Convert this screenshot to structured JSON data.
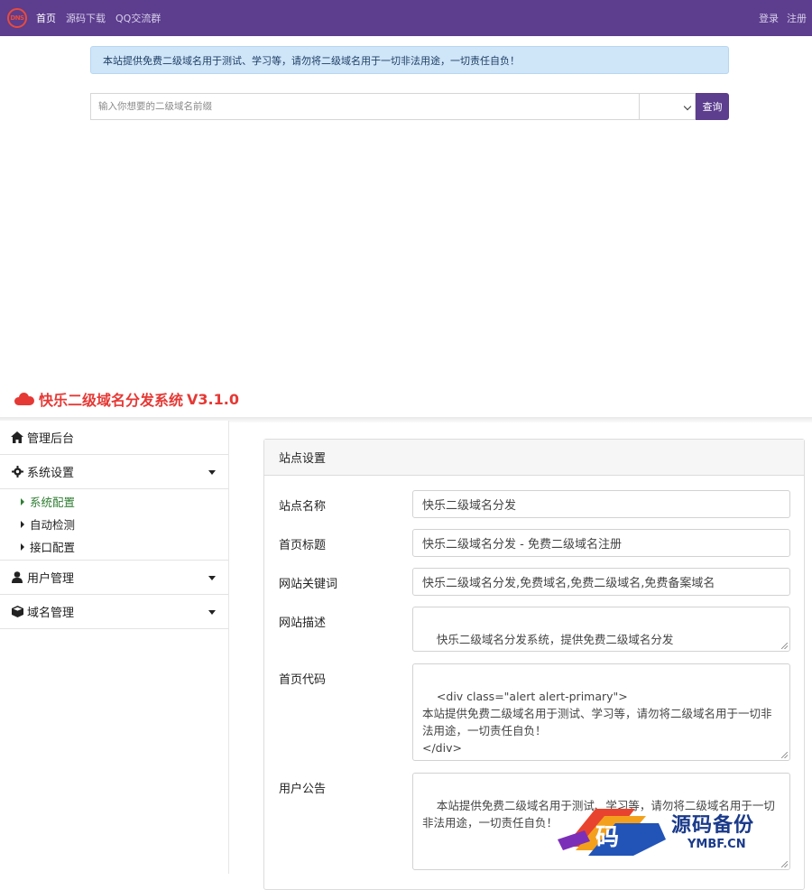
{
  "front": {
    "logo_text": "DNS",
    "nav": {
      "home": "首页",
      "download": "源码下载",
      "qq": "QQ交流群",
      "login": "登录",
      "register": "注册"
    },
    "alert": "本站提供免费二级域名用于测试、学习等，请勿将二级域名用于一切非法用途，一切责任自负！",
    "search": {
      "placeholder": "输入你想要的二级域名前缀",
      "select_value": "",
      "button": "查询"
    }
  },
  "admin": {
    "brand_title": "快乐二级域名分发系统",
    "brand_version": "V3.1.0",
    "sidebar": {
      "dashboard": "管理后台",
      "system": "系统设置",
      "system_items": [
        "系统配置",
        "自动检测",
        "接口配置"
      ],
      "users": "用户管理",
      "domains": "域名管理"
    },
    "panel": {
      "title": "站点设置",
      "fields": {
        "site_name_label": "站点名称",
        "site_name_value": "快乐二级域名分发",
        "home_title_label": "首页标题",
        "home_title_value": "快乐二级域名分发 - 免费二级域名注册",
        "keywords_label": "网站关键词",
        "keywords_value": "快乐二级域名分发,免费域名,免费二级域名,免费备案域名",
        "description_label": "网站描述",
        "description_value": "快乐二级域名分发系统，提供免费二级域名分发",
        "home_code_label": "首页代码",
        "home_code_value": "<div class=\"alert alert-primary\">\n本站提供免费二级域名用于测试、学习等，请勿将二级域名用于一切非法用途，一切责任自负！\n</div>",
        "notice_label": "用户公告",
        "notice_value": "本站提供免费二级域名用于测试、学习等，请勿将二级域名用于一切非法用途，一切责任自负！"
      }
    }
  },
  "watermark": {
    "glyph": "码",
    "text": "源码备份",
    "sub": "YMBF.CN"
  },
  "colors": {
    "nav_bg": "#5c3d8e",
    "alert_bg": "#cfe5f8",
    "brand_red": "#e53935",
    "active_green": "#2e7d32"
  }
}
